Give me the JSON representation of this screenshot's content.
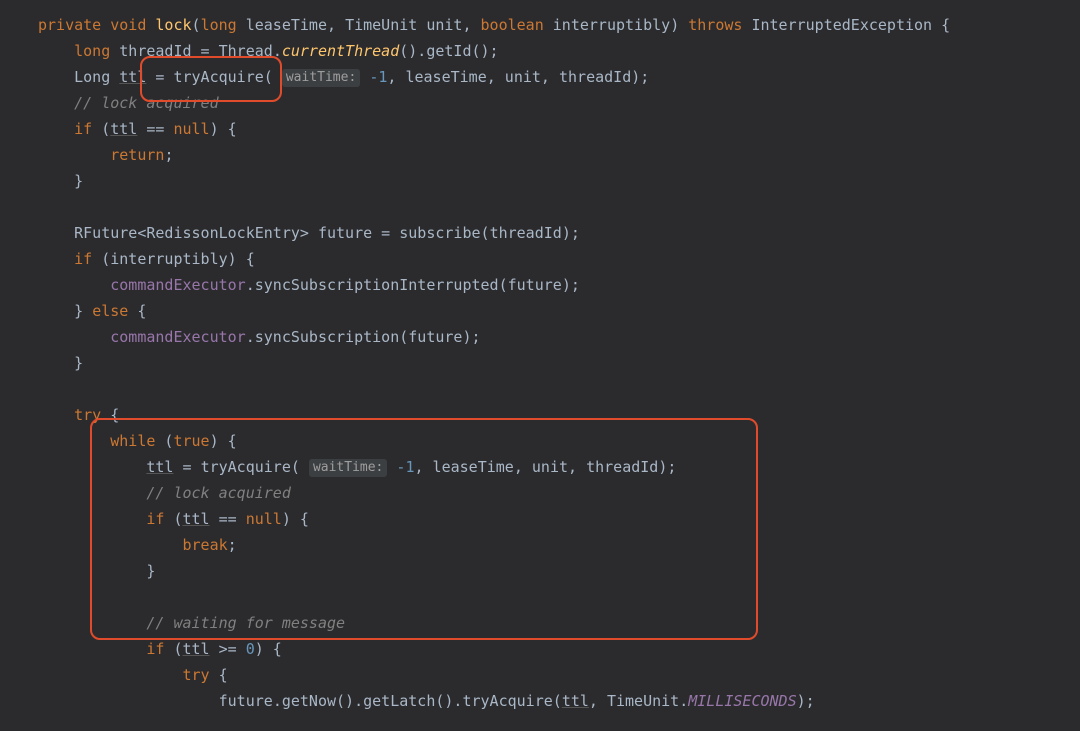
{
  "code": {
    "l1": {
      "t1": "private",
      "t2": "void",
      "t3": "lock",
      "t4": "long",
      "t5": "leaseTime",
      "t6": "TimeUnit",
      "t7": "unit",
      "t8": "boolean",
      "t9": "interruptibly",
      "t10": "throws",
      "t11": "InterruptedException"
    },
    "l2": {
      "t1": "long",
      "t2": "threadId",
      "t3": "Thread",
      "t4": "currentThread",
      "t5": "getId"
    },
    "l3": {
      "t1": "Long",
      "t2": "ttl",
      "t3": "tryAcquire",
      "t4": "waitTime:",
      "t5": "-1",
      "t6": "leaseTime",
      "t7": "unit",
      "t8": "threadId"
    },
    "l4": {
      "t1": "// lock acquired"
    },
    "l5": {
      "t1": "if",
      "t2": "ttl",
      "t3": "null"
    },
    "l6": {
      "t1": "return"
    },
    "l8": {
      "t1": "RFuture",
      "t2": "RedissonLockEntry",
      "t3": "future",
      "t4": "subscribe",
      "t5": "threadId"
    },
    "l9": {
      "t1": "if",
      "t2": "interruptibly"
    },
    "l10": {
      "t1": "commandExecutor",
      "t2": "syncSubscriptionInterrupted",
      "t3": "future"
    },
    "l11": {
      "t1": "else"
    },
    "l12": {
      "t1": "commandExecutor",
      "t2": "syncSubscription",
      "t3": "future"
    },
    "l14": {
      "t1": "try"
    },
    "l15": {
      "t1": "while",
      "t2": "true"
    },
    "l16": {
      "t1": "ttl",
      "t2": "tryAcquire",
      "t3": "waitTime:",
      "t4": "-1",
      "t5": "leaseTime",
      "t6": "unit",
      "t7": "threadId"
    },
    "l17": {
      "t1": "// lock acquired"
    },
    "l18": {
      "t1": "if",
      "t2": "ttl",
      "t3": "null"
    },
    "l19": {
      "t1": "break"
    },
    "l21": {
      "t1": "// waiting for message"
    },
    "l22": {
      "t1": "if",
      "t2": "ttl",
      "t3": "0"
    },
    "l23": {
      "t1": "try"
    },
    "l24": {
      "t1": "future",
      "t2": "getNow",
      "t3": "getLatch",
      "t4": "tryAcquire",
      "t5": "ttl",
      "t6": "TimeUnit",
      "t7": "MILLISECONDS"
    }
  }
}
